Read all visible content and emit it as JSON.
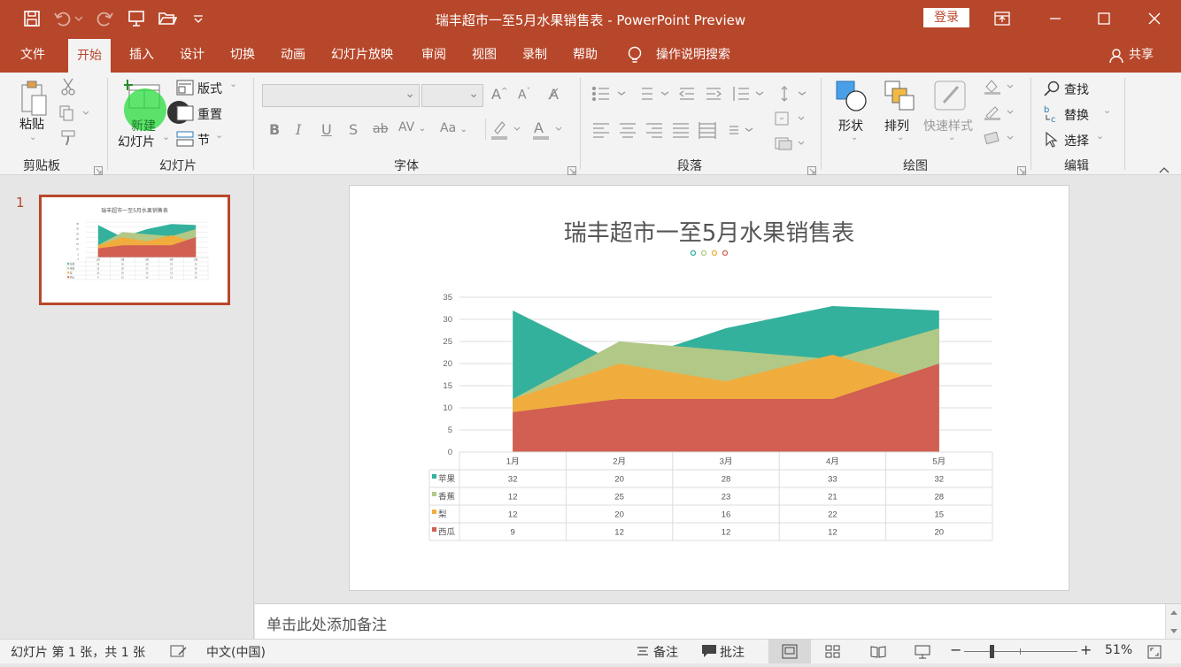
{
  "window": {
    "title": "瑞丰超市一至5月水果销售表  -  PowerPoint Preview",
    "login": "登录"
  },
  "tabs": [
    "文件",
    "开始",
    "插入",
    "设计",
    "切换",
    "动画",
    "幻灯片放映",
    "审阅",
    "视图",
    "录制",
    "帮助"
  ],
  "tell_me": "操作说明搜索",
  "share": "共享",
  "ribbon": {
    "clipboard": {
      "paste": "粘贴",
      "label": "剪贴板"
    },
    "slides": {
      "new_slide": "幻灯片",
      "new_overlay": "新建",
      "layout": "版式",
      "reset": "重置",
      "section": "节",
      "label": "幻灯片",
      "badge": "1"
    },
    "font": {
      "label": "字体"
    },
    "paragraph": {
      "label": "段落"
    },
    "drawing": {
      "shapes": "形状",
      "arrange": "排列",
      "quick_styles": "快速样式",
      "label": "绘图"
    },
    "editing": {
      "find": "查找",
      "replace": "替换",
      "select": "选择",
      "label": "编辑"
    }
  },
  "thumbnail": {
    "number": "1",
    "title": "瑞丰超市一至5月水果销售表"
  },
  "slide": {
    "title": "瑞丰超市一至5月水果销售表"
  },
  "chart_data": {
    "type": "area",
    "title": "瑞丰超市一至5月水果销售表",
    "categories": [
      "1月",
      "2月",
      "3月",
      "4月",
      "5月"
    ],
    "ylim": [
      0,
      35
    ],
    "yticks": [
      0,
      5,
      10,
      15,
      20,
      25,
      30,
      35
    ],
    "grid": true,
    "series": [
      {
        "name": "苹果",
        "values": [
          32,
          20,
          28,
          33,
          32
        ],
        "color": "#34b19c"
      },
      {
        "name": "香蕉",
        "values": [
          12,
          25,
          23,
          21,
          28
        ],
        "color": "#b2c886"
      },
      {
        "name": "梨",
        "values": [
          12,
          20,
          16,
          22,
          15
        ],
        "color": "#f0ad3e"
      },
      {
        "name": "西瓜",
        "values": [
          9,
          12,
          12,
          12,
          20
        ],
        "color": "#d15f52"
      }
    ],
    "data_table": true
  },
  "notes": {
    "placeholder": "单击此处添加备注"
  },
  "status": {
    "slide_info": "幻灯片 第 1 张，共 1 张",
    "language": "中文(中国)",
    "notes": "备注",
    "comments": "批注",
    "zoom": "51%"
  }
}
